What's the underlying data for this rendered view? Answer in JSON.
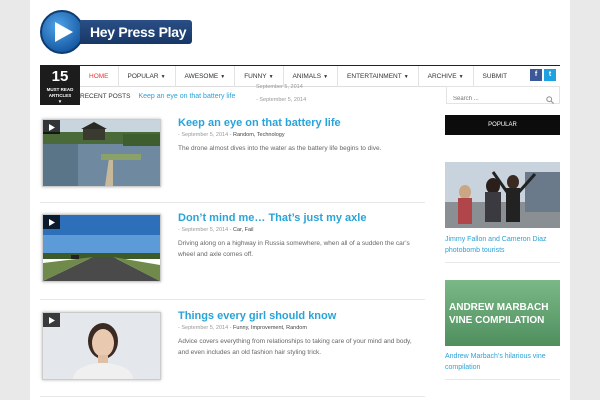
{
  "site": {
    "name": "Hey Press Play"
  },
  "must_read": {
    "count": "15",
    "label": "MUST READ ARTICLES"
  },
  "menu": [
    {
      "label": "HOME",
      "active": true,
      "caret": false
    },
    {
      "label": "POPULAR",
      "caret": true
    },
    {
      "label": "AWESOME",
      "caret": true
    },
    {
      "label": "FUNNY",
      "caret": true
    },
    {
      "label": "ANIMALS",
      "caret": true
    },
    {
      "label": "ENTERTAINMENT",
      "caret": true
    },
    {
      "label": "ARCHIVE",
      "caret": true
    },
    {
      "label": "SUBMIT",
      "caret": false
    }
  ],
  "social": {
    "facebook": "f",
    "twitter": "t"
  },
  "recent": {
    "label": "RECENT POSTS",
    "current": "Keep an eye on that battery life",
    "ticker_above": "September 5, 2014",
    "ticker_below": "- September 5, 2014"
  },
  "search": {
    "placeholder": "Search ..."
  },
  "posts": [
    {
      "title": "Keep an eye on that battery life",
      "date": "- September 5, 2014 - ",
      "categories": "Random, Technology",
      "excerpt": "The drone almost dives into the water as the battery life begins to dive."
    },
    {
      "title": "Don’t mind me… That’s just my axle",
      "date": "- September 5, 2014 - ",
      "categories": "Car, Fail",
      "excerpt": "Driving along on a highway in Russia somewhere,  when all of a sudden the car’s wheel and axle comes off."
    },
    {
      "title": "Things every girl should know",
      "date": "- September 5, 2014 - ",
      "categories": "Funny, Improvement, Random",
      "excerpt": "Advice covers everything from relationships to taking care of your mind and body, and even includes an old fashion hair styling trick."
    }
  ],
  "sidebar": {
    "heading": "POPULAR",
    "items": [
      {
        "caption": "Jimmy Fallon and Cameron Diaz photobomb tourists"
      },
      {
        "caption": "Andrew Marbach’s hilarious vine compilation",
        "image_text_1": "ANDREW MARBACH",
        "image_text_2": "VINE COMPILATION"
      }
    ]
  },
  "colors": {
    "link": "#29a3d8",
    "active": "#e33333",
    "dark": "#1c1c1c",
    "facebook": "#3b5998",
    "twitter": "#1fa0e0"
  }
}
